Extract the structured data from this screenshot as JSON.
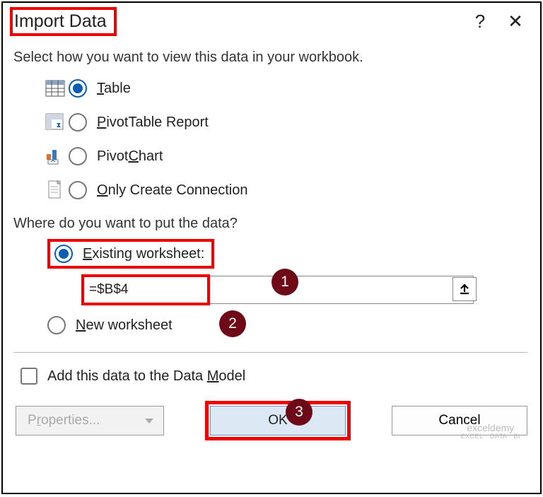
{
  "dialog": {
    "title": "Import Data",
    "instruction": "Select how you want to view this data in your workbook.",
    "view_options": {
      "table": "Table",
      "pivot_table": "PivotTable Report",
      "pivot_chart": "PivotChart",
      "only_connection": "Only Create Connection"
    },
    "where_question": "Where do you want to put the data?",
    "location": {
      "existing_label": "Existing worksheet:",
      "existing_value": "=$B$4",
      "new_label": "New worksheet"
    },
    "data_model_label": "Add this data to the Data Model",
    "buttons": {
      "properties": "Properties...",
      "ok": "OK",
      "cancel": "Cancel"
    }
  },
  "badges": {
    "b1": "1",
    "b2": "2",
    "b3": "3"
  },
  "watermark": {
    "line1": "exceldemy",
    "line2": "EXCEL · DATA · BI"
  }
}
